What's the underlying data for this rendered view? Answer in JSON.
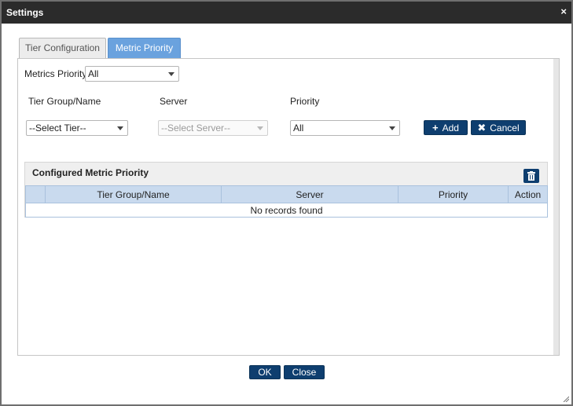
{
  "window": {
    "title": "Settings",
    "close_glyph": "×"
  },
  "tabs": [
    {
      "label": "Tier Configuration",
      "active": false
    },
    {
      "label": "Metric Priority",
      "active": true
    }
  ],
  "form": {
    "metrics_priority_label": "Metrics Priority:",
    "metrics_priority_value": "All",
    "tier_group_label": "Tier Group/Name",
    "server_label": "Server",
    "priority_label": "Priority",
    "tier_select_value": "--Select Tier--",
    "server_select_value": "--Select Server--",
    "priority_select_value": "All",
    "add_label": "Add",
    "cancel_label": "Cancel"
  },
  "grid": {
    "title": "Configured Metric Priority",
    "columns": [
      "",
      "Tier Group/Name",
      "Server",
      "Priority",
      "Action"
    ],
    "empty_message": "No records found"
  },
  "footer": {
    "ok_label": "OK",
    "close_label": "Close"
  },
  "icons": {
    "add": "plus-icon",
    "cancel": "x-icon",
    "delete": "trash-icon",
    "dropdown": "chevron-down-icon",
    "resize": "resize-grip-icon"
  },
  "colors": {
    "titlebar": "#2b2b2b",
    "active_tab": "#6aa2de",
    "primary_button": "#0e3e6f",
    "grid_header": "#c9daee"
  }
}
